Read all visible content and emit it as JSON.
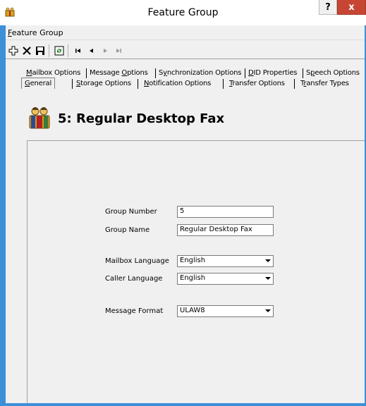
{
  "window": {
    "title": "Feature Group",
    "help_label": "?",
    "close_label": "x"
  },
  "menu": {
    "items": [
      {
        "label_first": "F",
        "label_rest": "eature Group"
      }
    ]
  },
  "toolbar": {
    "buttons": [
      "add-icon",
      "delete-icon",
      "save-icon",
      "refresh-icon",
      "first-record-icon",
      "previous-record-icon",
      "next-record-icon",
      "last-record-icon"
    ]
  },
  "tabs": {
    "row1": [
      {
        "first": "M",
        "rest": "ailbox Options"
      },
      {
        "pre": "Message ",
        "first": "O",
        "rest": "ptions"
      },
      {
        "pre": "S",
        "first": "y",
        "rest": "nchronization Options"
      },
      {
        "first": "D",
        "rest": "ID Properties"
      },
      {
        "pre": "S",
        "first": "p",
        "rest": "eech Options"
      }
    ],
    "row2": [
      {
        "first": "G",
        "rest": "eneral"
      },
      {
        "first": "S",
        "rest": "torage Options"
      },
      {
        "first": "N",
        "rest": "otification Options"
      },
      {
        "first": "T",
        "rest": "ransfer Options"
      },
      {
        "pre": "T",
        "first": "r",
        "rest": "ansfer Types"
      }
    ]
  },
  "header": {
    "title": "5: Regular Desktop Fax"
  },
  "form": {
    "group_number_label": "Group Number",
    "group_number_value": "5",
    "group_name_label": "Group Name",
    "group_name_value": "Regular Desktop Fax",
    "mailbox_language_label": "Mailbox Language",
    "mailbox_language_value": "English",
    "caller_language_label": "Caller Language",
    "caller_language_value": "English",
    "message_format_label": "Message Format",
    "message_format_value": "ULAW8"
  },
  "colors": {
    "frame_accent": "#3d8fd6",
    "close_button": "#c74533",
    "client_background": "#f0f0f0"
  }
}
